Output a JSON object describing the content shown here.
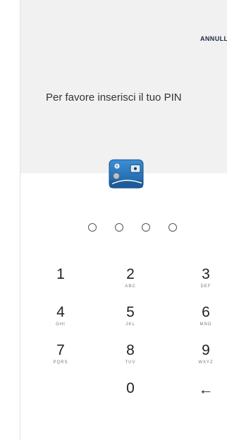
{
  "header": {
    "cancel_label": "ANNULLA",
    "title": "Per favore inserisci il tuo PIN"
  },
  "pin": {
    "length": 4,
    "entered": 0
  },
  "keypad": {
    "keys": [
      {
        "digit": "1",
        "letters": ""
      },
      {
        "digit": "2",
        "letters": "ABC"
      },
      {
        "digit": "3",
        "letters": "DEF"
      },
      {
        "digit": "4",
        "letters": "GHI"
      },
      {
        "digit": "5",
        "letters": "JKL"
      },
      {
        "digit": "6",
        "letters": "MNO"
      },
      {
        "digit": "7",
        "letters": "PQRS"
      },
      {
        "digit": "8",
        "letters": "TUV"
      },
      {
        "digit": "9",
        "letters": "WXYZ"
      },
      {
        "digit": "0",
        "letters": ""
      }
    ],
    "backspace_icon": "backspace-arrow-icon",
    "backspace_glyph": "←"
  },
  "icons": {
    "wallet": "wallet-icon"
  },
  "colors": {
    "header_bg": "#f1f1f1",
    "accent": "#1f2a44",
    "wallet_blue": "#2a7ac0"
  }
}
